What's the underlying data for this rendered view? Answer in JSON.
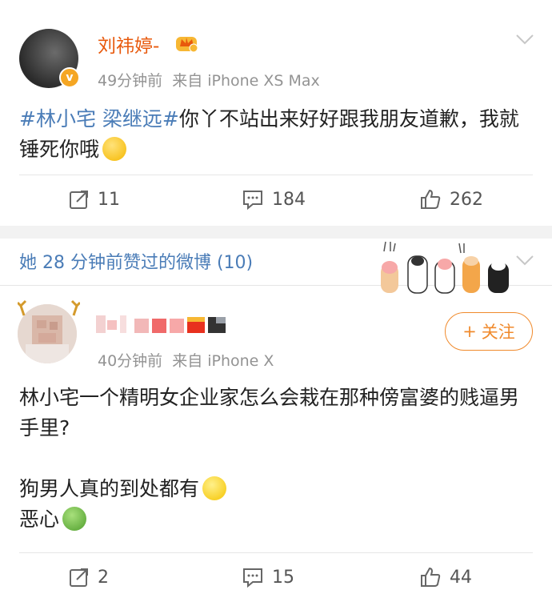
{
  "post1": {
    "username": "刘祎婷-",
    "verified_badge": "v",
    "time": "49分钟前",
    "source": "来自 iPhone XS Max",
    "hashtag": "#林小宅 梁继远#",
    "text": "你丫不站出来好好跟我朋友道歉，我就锤死你哦",
    "emoji": "hug-emoji",
    "reposts": "11",
    "comments": "184",
    "likes": "262"
  },
  "liked_header": {
    "text": "她 28 分钟前赞过的微博 (10)"
  },
  "post2": {
    "username_obscured": "pixelated",
    "time": "40分钟前",
    "source": "来自 iPhone X",
    "follow_label": "关注",
    "follow_icon": "+",
    "paragraphs": [
      "林小宅一个精明女企业家怎么会栽在那种傍富婆的贱逼男手里?",
      "狗男人真的到处都有",
      "恶心"
    ],
    "emojis": [
      "smile-emoji",
      "sick-emoji"
    ],
    "reposts": "2",
    "comments": "15",
    "likes": "44"
  },
  "colors": {
    "username": "#e8590c",
    "link": "#4a7cb7",
    "follow": "#f08a2c",
    "meta": "#939393"
  }
}
